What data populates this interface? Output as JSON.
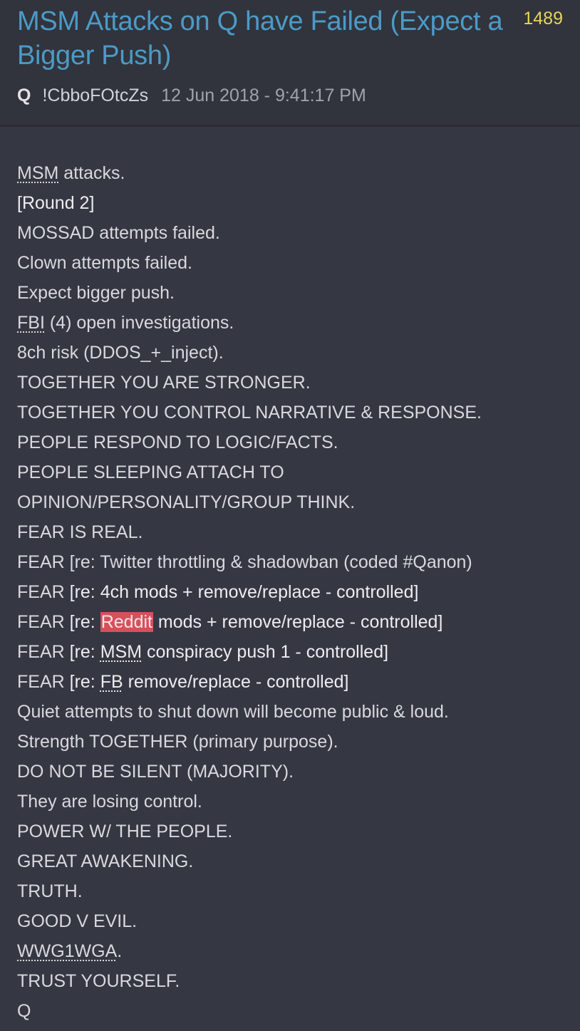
{
  "post": {
    "title": "MSM Attacks on Q have Failed (Expect a Bigger Push)",
    "number": "1489",
    "author": "Q",
    "tripcode": "!CbboFOtcZs",
    "timestamp": "12 Jun 2018 - 9:41:17 PM"
  },
  "accent_colors": {
    "title": "#4c9ac7",
    "post_number": "#e6d45a",
    "highlight": "#d6505c",
    "background": "#353842"
  },
  "body": {
    "l1_abbr": "MSM",
    "l1_rest": " attacks.",
    "l2": "[Round 2]",
    "l3": "MOSSAD attempts failed.",
    "l4": "Clown attempts failed.",
    "l5": "Expect bigger push.",
    "l6_abbr": "FBI",
    "l6_rest": " (4) open investigations.",
    "l7": "8ch risk (DDOS_+_inject).",
    "l8": "TOGETHER YOU ARE STRONGER.",
    "l9": "TOGETHER YOU CONTROL NARRATIVE & RESPONSE.",
    "l10": "PEOPLE RESPOND TO LOGIC/FACTS.",
    "l11": "PEOPLE SLEEPING ATTACH TO",
    "l12": "OPINION/PERSONALITY/GROUP THINK.",
    "l13": "FEAR IS REAL.",
    "l14": "FEAR [re: Twitter throttling & shadowban (coded #Qanon)",
    "l15_a": "FEAR ",
    "l15_b": "[re: 4ch mods + remove/replace - controlled]",
    "l16_a": "FEAR ",
    "l16_b": "[re: ",
    "l16_hl": "Reddit",
    "l16_c": " mods + remove/replace - controlled]",
    "l17_a": "FEAR ",
    "l17_b": "[re: ",
    "l17_abbr": "MSM",
    "l17_c": " conspiracy push 1 - controlled]",
    "l18_a": "FEAR ",
    "l18_b": "[re: ",
    "l18_abbr": "FB",
    "l18_c": " remove/replace - controlled]",
    "l19": "Quiet attempts to shut down will become public & loud.",
    "l20": "Strength TOGETHER (primary purpose).",
    "l21": "DO NOT BE SILENT (MAJORITY).",
    "l22": "They are losing control.",
    "l23": "POWER W/ THE PEOPLE.",
    "l24": "GREAT AWAKENING.",
    "l25": "TRUTH.",
    "l26": "GOOD V EVIL.",
    "l27_abbr": "WWG1WGA",
    "l27_rest": ".",
    "l28": "TRUST YOURSELF.",
    "l29": "Q"
  }
}
